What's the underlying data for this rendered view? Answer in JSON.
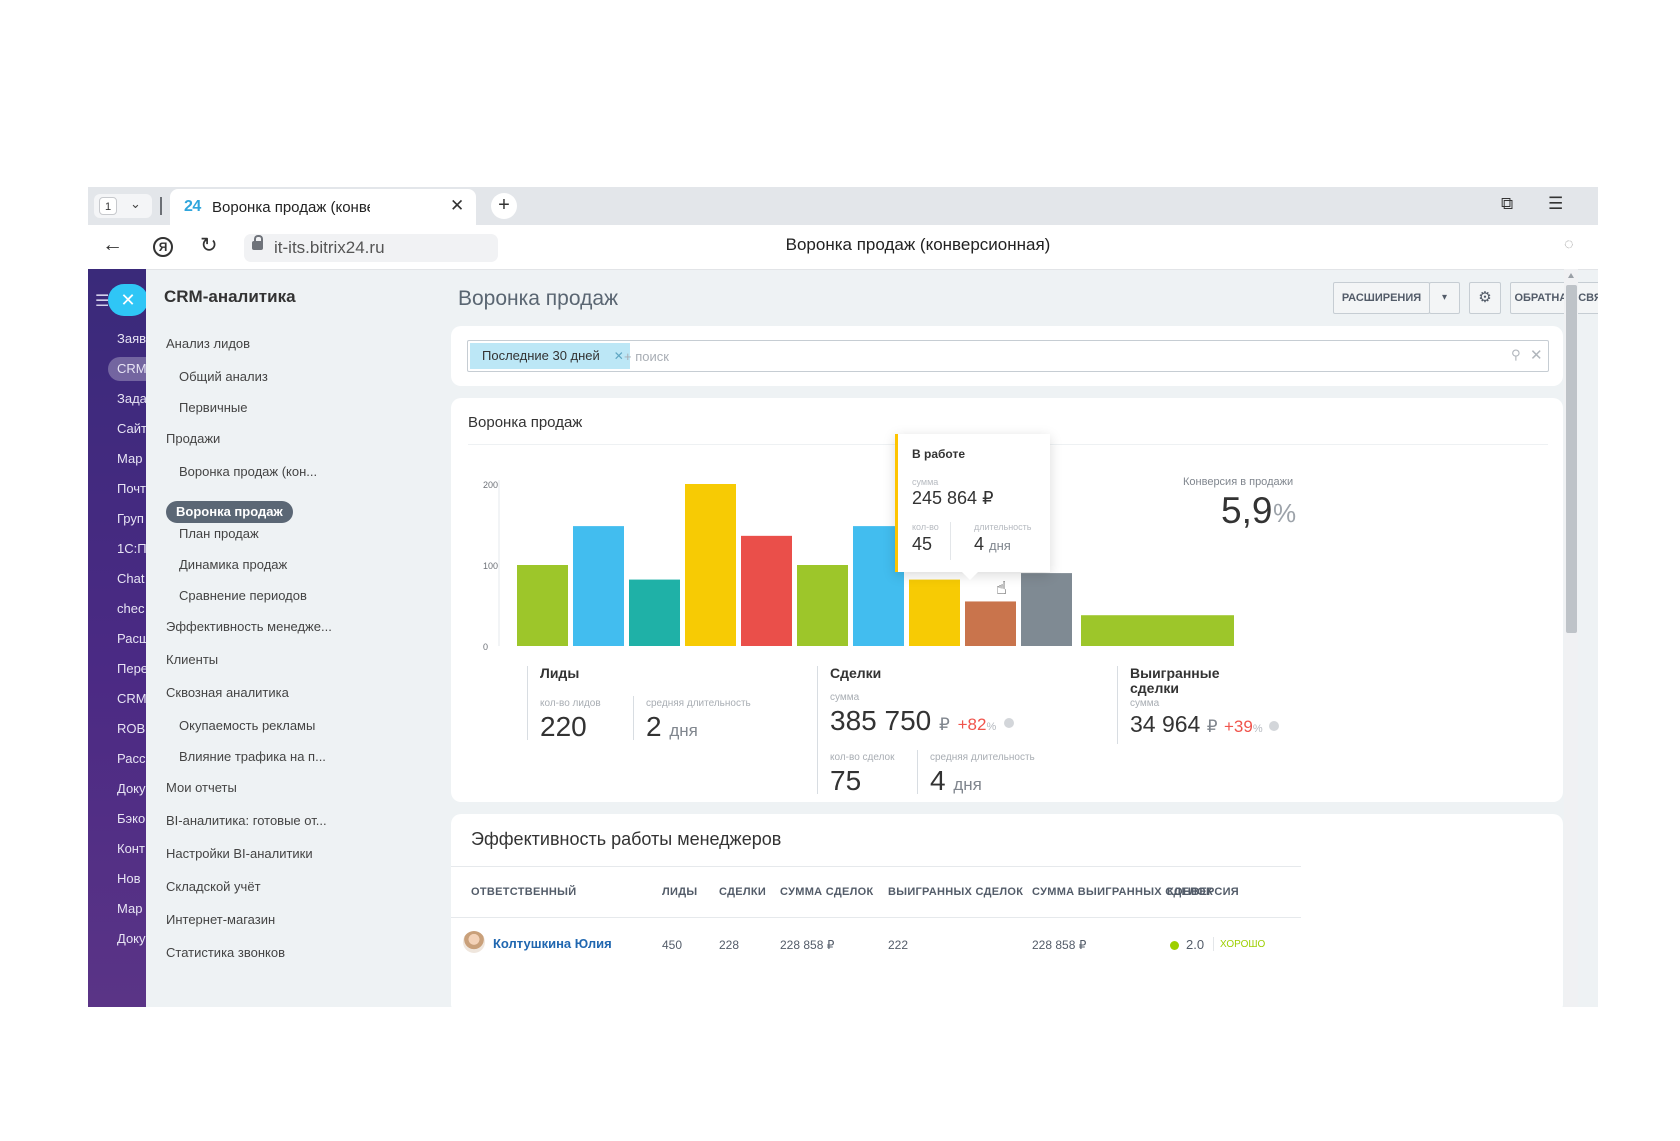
{
  "browser": {
    "tab_counter": "1",
    "tab_favicon": "24",
    "tab_title": "Воронка продаж (конверсионная)",
    "url": "it-its.bitrix24.ru",
    "page_title": "Воронка продаж (конверсионная)"
  },
  "left_menu": {
    "items": [
      "Заяв",
      "CRM",
      "Зада",
      "Сайт",
      "Мар",
      "Почт",
      "Груп",
      "1С:П",
      "Chat",
      "chec",
      "Расш",
      "Пере",
      "CRM",
      "ROB",
      "Расс",
      "Доку",
      "Бэко",
      "Конт",
      "Нов",
      "Мар",
      "Доку"
    ]
  },
  "sidebar": {
    "title": "CRM-аналитика",
    "items": [
      {
        "label": "Анализ лидов"
      },
      {
        "label": "Общий анализ"
      },
      {
        "label": "Первичные"
      },
      {
        "label": "Продажи"
      },
      {
        "label": "Воронка продаж (кон..."
      },
      {
        "label": "Воронка продаж"
      },
      {
        "label": "План продаж"
      },
      {
        "label": "Динамика продаж"
      },
      {
        "label": "Сравнение периодов"
      },
      {
        "label": "Эффективность менедже..."
      },
      {
        "label": "Клиенты"
      },
      {
        "label": "Сквозная аналитика"
      },
      {
        "label": "Окупаемость рекламы"
      },
      {
        "label": "Влияние трафика на п..."
      },
      {
        "label": "Мои отчеты"
      },
      {
        "label": "BI-аналитика: готовые от..."
      },
      {
        "label": "Настройки BI-аналитики"
      },
      {
        "label": "Складской учёт"
      },
      {
        "label": "Интернет-магазин"
      },
      {
        "label": "Статистика звонков"
      }
    ]
  },
  "header": {
    "title": "Воронка продаж",
    "extensions_label": "РАСШИРЕНИЯ",
    "feedback_label": "ОБРАТНАЯ СВЯЗЬ"
  },
  "filter": {
    "chip": "Последние 30 дней",
    "placeholder": "+ поиск"
  },
  "funnel": {
    "title": "Воронка продаж",
    "conversion_label": "Конверсия в продажи",
    "conversion_value": "5,9",
    "conversion_unit": "%",
    "leads": {
      "title": "Лиды",
      "count_label": "кол-во лидов",
      "count": "220",
      "duration_label": "средняя длительность",
      "duration": "2",
      "duration_unit": "дня"
    },
    "deals": {
      "title": "Сделки",
      "sum_label": "сумма",
      "sum": "385 750",
      "currency": "₽",
      "delta": "+82",
      "pct": "%",
      "count_label": "кол-во сделок",
      "count": "75",
      "duration_label": "средняя длительность",
      "duration": "4",
      "duration_unit": "дня"
    },
    "won": {
      "title": "Выигранные сделки",
      "sum_label": "сумма",
      "sum": "34 964",
      "currency": "₽",
      "delta": "+39",
      "pct": "%"
    },
    "tooltip": {
      "title": "В работе",
      "sum_label": "сумма",
      "sum": "245 864 ₽",
      "count_label": "кол-во",
      "count": "45",
      "duration_label": "длительность",
      "duration": "4",
      "duration_unit": "дня"
    }
  },
  "chart_data": {
    "type": "bar",
    "categories": [
      "",
      "",
      "",
      "",
      "",
      "",
      "",
      "",
      "",
      "",
      ""
    ],
    "values": [
      100,
      148,
      82,
      200,
      136,
      100,
      148,
      82,
      55,
      90,
      38
    ],
    "colors": [
      "#9dc62a",
      "#42bdef",
      "#1fb1a7",
      "#f7cb04",
      "#ea4f4a",
      "#9dc62a",
      "#42bdef",
      "#f7cb04",
      "#c9744c",
      "#7f8a93",
      "#9dc62a"
    ],
    "ylim": [
      0,
      200
    ],
    "yticks": [
      "0",
      "100",
      "200"
    ],
    "xlabel": "",
    "ylabel": ""
  },
  "managers": {
    "title": "Эффективность работы менеджеров",
    "columns": [
      "ОТВЕТСТВЕННЫЙ",
      "ЛИДЫ",
      "СДЕЛКИ",
      "СУММА СДЕЛОК",
      "ВЫИГРАННЫХ СДЕЛОК",
      "СУММА ВЫИГРАННЫХ СДЕЛОК",
      "КОНВЕРСИЯ"
    ],
    "rows": [
      {
        "name": "Колтушкина Юлия",
        "leads": "450",
        "deals": "228",
        "sum": "228 858 ₽",
        "won": "222",
        "won_sum": "228 858 ₽",
        "conversion": "2.0",
        "grade": "ХОРОШО"
      }
    ]
  }
}
